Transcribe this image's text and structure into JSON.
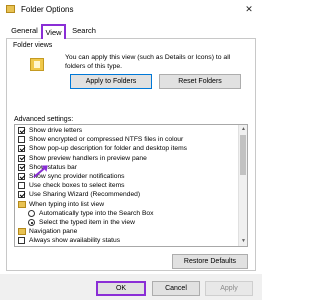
{
  "window": {
    "title": "Folder Options",
    "close_glyph": "✕"
  },
  "tabs": [
    {
      "label": "General",
      "active": false
    },
    {
      "label": "View",
      "active": true
    },
    {
      "label": "Search",
      "active": false
    }
  ],
  "folder_views": {
    "title": "Folder views",
    "description": "You can apply this view (such as Details or Icons) to all folders of this type.",
    "apply_button": "Apply to Folders",
    "reset_button": "Reset Folders"
  },
  "advanced": {
    "title": "Advanced settings:",
    "items": [
      {
        "type": "checkbox",
        "checked": true,
        "label": "Show drive letters",
        "indent": 0
      },
      {
        "type": "checkbox",
        "checked": false,
        "label": "Show encrypted or compressed NTFS files in colour",
        "indent": 0
      },
      {
        "type": "checkbox",
        "checked": true,
        "label": "Show pop-up description for folder and desktop items",
        "indent": 0
      },
      {
        "type": "checkbox",
        "checked": true,
        "label": "Show preview handlers in preview pane",
        "indent": 0
      },
      {
        "type": "checkbox",
        "checked": true,
        "label": "Show status bar",
        "indent": 0
      },
      {
        "type": "checkbox",
        "checked": true,
        "label": "Show sync provider notifications",
        "indent": 0
      },
      {
        "type": "checkbox",
        "checked": false,
        "label": "Use check boxes to select items",
        "indent": 0
      },
      {
        "type": "checkbox",
        "checked": true,
        "label": "Use Sharing Wizard (Recommended)",
        "indent": 0
      },
      {
        "type": "folder",
        "label": "When typing into list view",
        "indent": 0
      },
      {
        "type": "radio",
        "checked": false,
        "label": "Automatically type into the Search Box",
        "indent": 1
      },
      {
        "type": "radio",
        "checked": true,
        "label": "Select the typed item in the view",
        "indent": 1
      },
      {
        "type": "folder",
        "label": "Navigation pane",
        "indent": 0
      },
      {
        "type": "checkbox",
        "checked": false,
        "label": "Always show availability status",
        "indent": 0
      }
    ]
  },
  "restore_button": "Restore Defaults",
  "footer": {
    "ok": "OK",
    "cancel": "Cancel",
    "apply": "Apply"
  },
  "colors": {
    "highlight": "#8a2ed6",
    "accent": "#0078d7"
  }
}
